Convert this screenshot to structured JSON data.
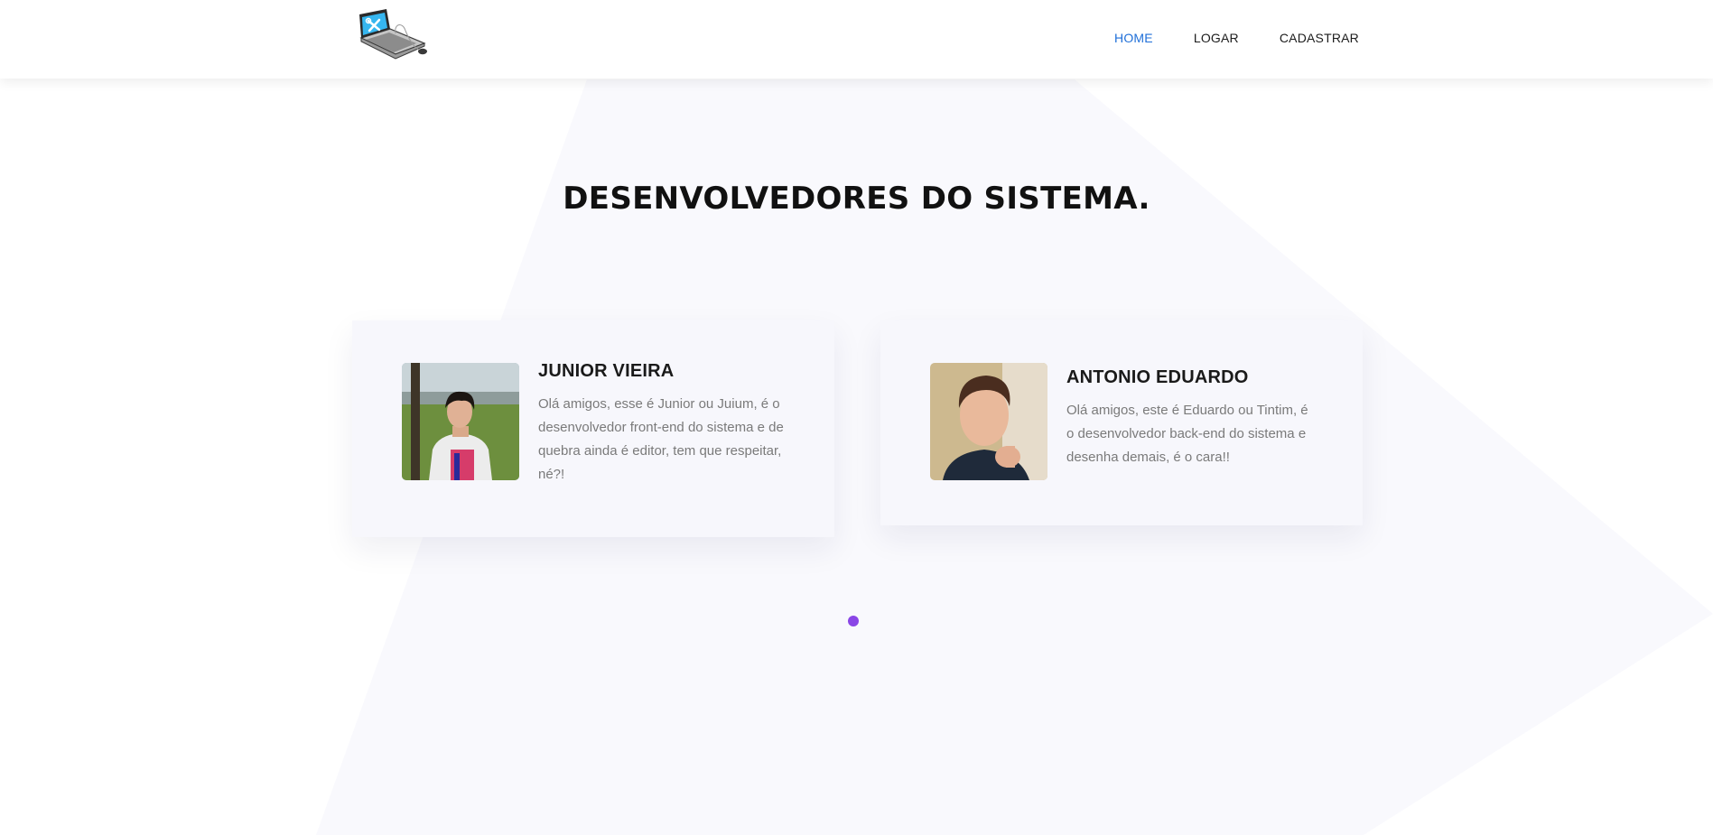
{
  "nav": {
    "items": [
      {
        "label": "HOME",
        "active": true
      },
      {
        "label": "LOGAR",
        "active": false
      },
      {
        "label": "CADASTRAR",
        "active": false
      }
    ]
  },
  "section": {
    "title": "DESENVOLVEDORES DO SISTEMA."
  },
  "developers": [
    {
      "name": "JUNIOR VIEIRA",
      "description": "Olá amigos, esse é Junior ou Juium, é o desenvolvedor front-end do sistema e de quebra ainda é editor, tem que respeitar, né?!"
    },
    {
      "name": "ANTONIO EDUARDO",
      "description": "Olá amigos, este é Eduardo ou Tintim, é o desenvolvedor back-end do sistema e desenha demais, é o cara!!"
    }
  ],
  "carousel": {
    "active_index": 0
  },
  "colors": {
    "nav_active": "#1f6fd8",
    "nav_text": "#1c1c1c",
    "card_background": "#f7f7fc",
    "background_shape": "#f9f9fd",
    "carousel_dot": "#8a46e6"
  },
  "icons": {
    "logo": "laptop-tools-icon"
  }
}
